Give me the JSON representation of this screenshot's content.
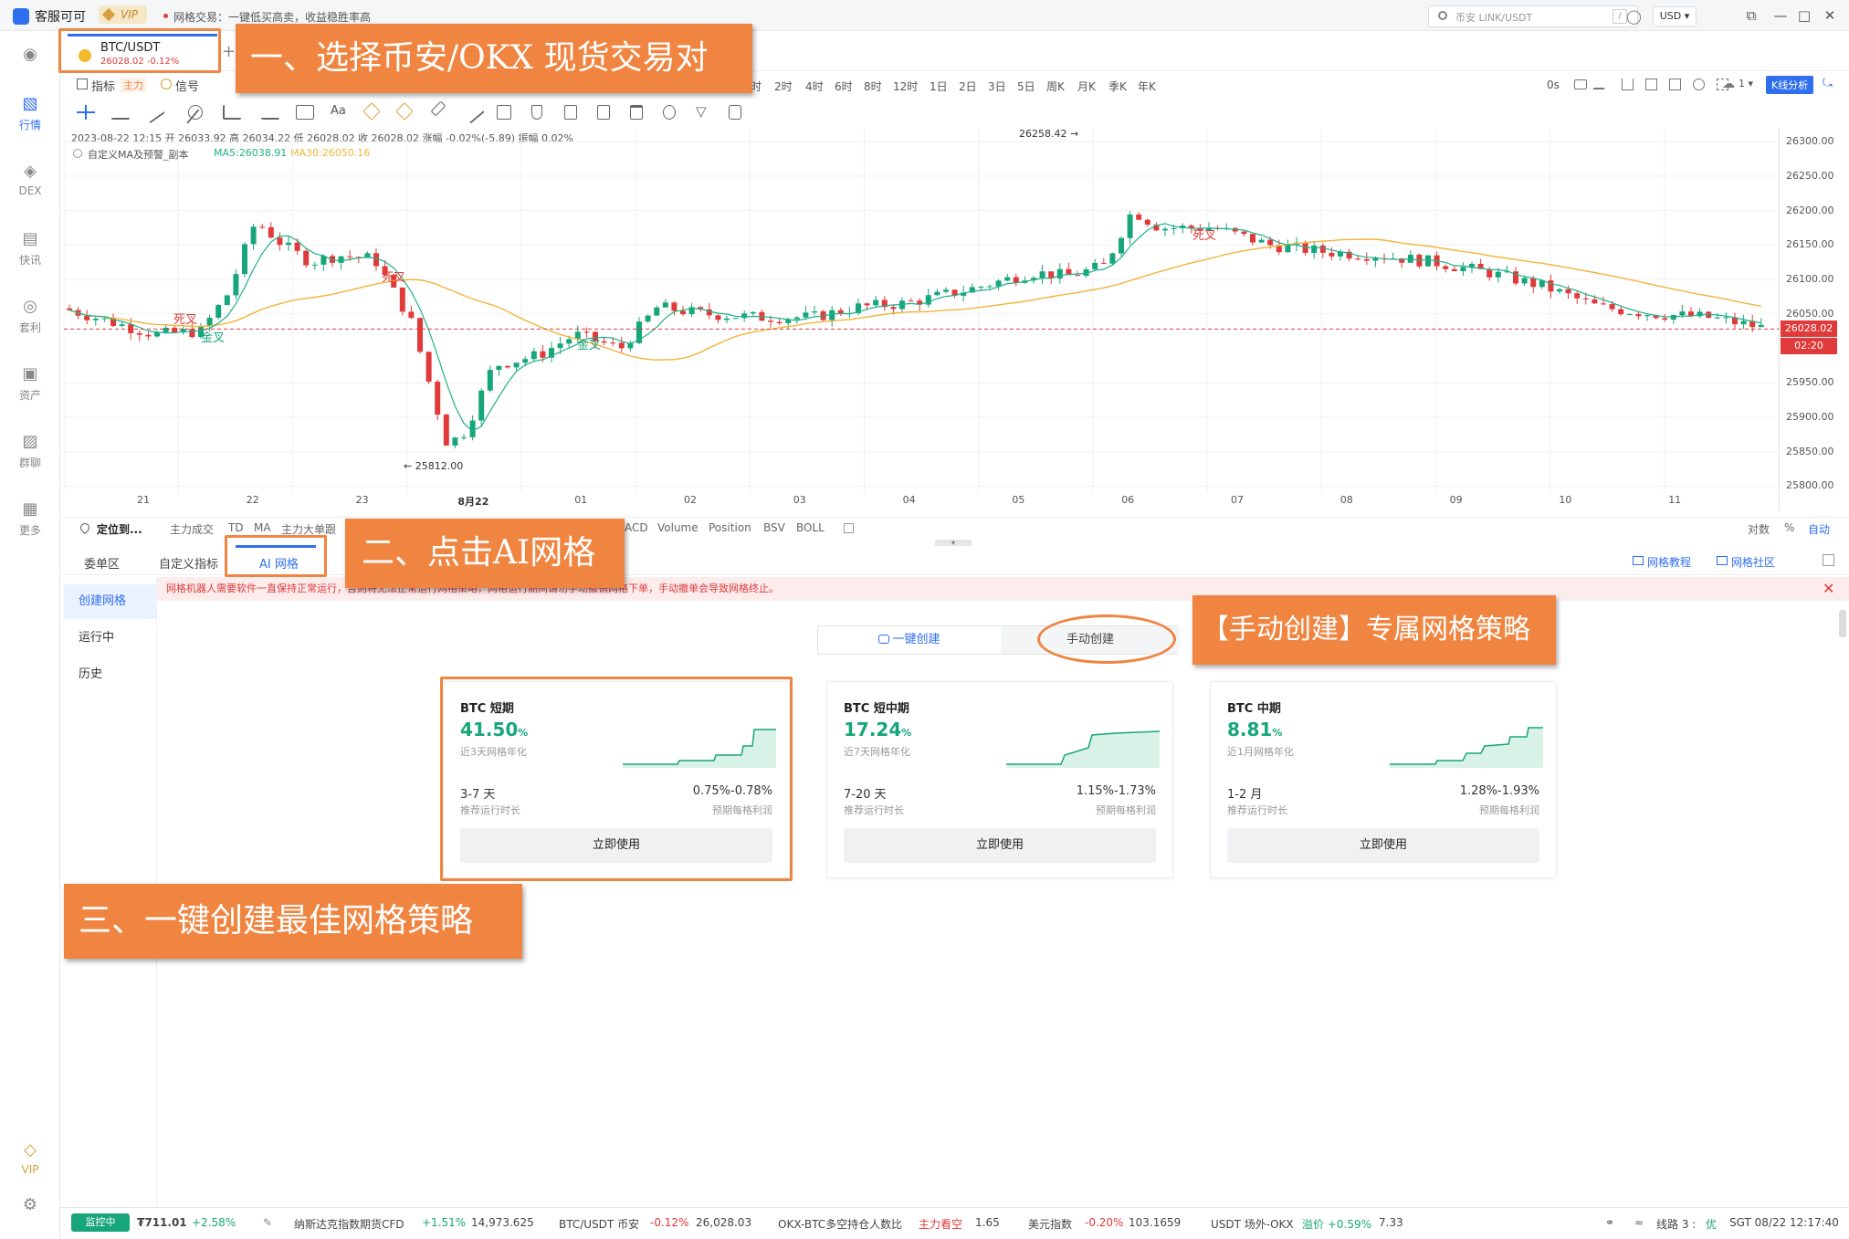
{
  "titlebar": {
    "app_name": "客服可可",
    "vip": "VIP",
    "notice": "网格交易：一键低买高卖，收益稳胜率高",
    "search_placeholder": "币安 LINK/USDT",
    "search_key": "/",
    "currency": "USD ▾"
  },
  "nav": [
    {
      "label": "",
      "icon": "globe-icon"
    },
    {
      "label": "行情",
      "icon": "chart-bars-icon"
    },
    {
      "label": "DEX",
      "icon": "dex-icon"
    },
    {
      "label": "快讯",
      "icon": "news-icon"
    },
    {
      "label": "套利",
      "icon": "arbitrage-icon"
    },
    {
      "label": "资产",
      "icon": "wallet-icon"
    },
    {
      "label": "群聊",
      "icon": "chat-icon"
    },
    {
      "label": "更多",
      "icon": "grid-icon"
    },
    {
      "label": "VIP",
      "icon": "vip-icon"
    },
    {
      "label": "",
      "icon": "settings-icon"
    }
  ],
  "symbol": {
    "pair": "BTC/USDT",
    "price": "26028.02  -0.12%"
  },
  "toolbar": {
    "indicator": "指标",
    "main": "主力",
    "signal": "信号",
    "timeframes": [
      "时",
      "2时",
      "4时",
      "6时",
      "8时",
      "12时",
      "1日",
      "2日",
      "3日",
      "5日",
      "周K",
      "月K",
      "季K",
      "年K"
    ],
    "countdown": "0s",
    "layout_count": "1 ▾",
    "k_analysis": "K线分析",
    "drawing_text": "Aa"
  },
  "chart_info": {
    "line1": "2023-08-22 12:15  开 26033.92  高 26034.22  低 26028.02  收 26028.02  涨幅 -0.02%(-5.89)  振幅 0.02%",
    "line2_name": "自定义MA及预警_副本",
    "ma5": "MA5:26038.91",
    "ma30": "MA30:26050.16"
  },
  "chart_data": {
    "type": "candlestick",
    "y_ticks": [
      "26300.00",
      "26250.00",
      "26200.00",
      "26150.00",
      "26100.00",
      "26050.00",
      "25950.00",
      "25900.00",
      "25850.00",
      "25800.00"
    ],
    "ylim": [
      25790,
      26320
    ],
    "x_ticks": [
      "21",
      "22",
      "23",
      "8月22",
      "01",
      "02",
      "03",
      "04",
      "05",
      "06",
      "07",
      "08",
      "09",
      "10",
      "11"
    ],
    "last_price": "26028.02",
    "last_price_value": 26028.02,
    "countdown_tag": "02:20",
    "high_label": "26258.42",
    "low_label": "25812.00",
    "annotations": [
      {
        "text": "死叉",
        "kind": "dead-cross"
      },
      {
        "text": "金叉",
        "kind": "golden-cross"
      },
      {
        "text": "死叉",
        "kind": "dead-cross"
      },
      {
        "text": "金叉",
        "kind": "golden-cross"
      },
      {
        "text": "死叉",
        "kind": "dead-cross"
      }
    ],
    "colors": {
      "up": "#17a67a",
      "down": "#e03a3a",
      "ma5": "#1fb089",
      "ma30": "#f3b43a"
    }
  },
  "indbar": {
    "locate": "定位到...",
    "items": [
      "主力成交",
      "TD",
      "MA",
      "主力大单跟",
      "ACD",
      "Volume",
      "Position",
      "BSV",
      "BOLL"
    ],
    "right": [
      "对数",
      "%",
      "自动"
    ]
  },
  "panel": {
    "tabs": [
      "委单区",
      "自定义指标",
      "AI 网格"
    ],
    "right_links": [
      "网格教程",
      "网格社区"
    ],
    "subnav": [
      "创建网格",
      "运行中",
      "历史"
    ],
    "warning": "网格机器人需要软件一直保持正常运行，否则将无法正常运行网格策略，网格运行期间请勿手动撤销网格下单，手动撤单会导致网格终止。",
    "seg": [
      "一键创建",
      "手动创建"
    ],
    "cards": [
      {
        "title": "BTC 短期",
        "rate": "41.50",
        "rate_unit": "%",
        "rate_sub": "近3天网格年化",
        "dur": "3-7 天",
        "dur_sub": "推荐运行时长",
        "profit": "0.75%-0.78%",
        "profit_sub": "预期每格利润",
        "button": "立即使用"
      },
      {
        "title": "BTC 短中期",
        "rate": "17.24",
        "rate_unit": "%",
        "rate_sub": "近7天网格年化",
        "dur": "7-20 天",
        "dur_sub": "推荐运行时长",
        "profit": "1.15%-1.73%",
        "profit_sub": "预期每格利润",
        "button": "立即使用"
      },
      {
        "title": "BTC 中期",
        "rate": "8.81",
        "rate_unit": "%",
        "rate_sub": "近1月网格年化",
        "dur": "1-2 月",
        "dur_sub": "推荐运行时长",
        "profit": "1.28%-1.93%",
        "profit_sub": "预期每格利润",
        "button": "立即使用"
      }
    ]
  },
  "annotations": {
    "a1": "一、选择币安/OKX 现货交易对",
    "a2": "二、点击AI网格",
    "a3": "【手动创建】专属网格策略",
    "a4": "三、一键创建最佳网格策略"
  },
  "footer": {
    "monitor": "监控中",
    "balance": "₮711.01",
    "balance_chg": "+2.58%",
    "items": [
      {
        "name": "纳斯达克指数期货CFD",
        "chg": "+1.51%",
        "val": "14,973.625",
        "dir": "up"
      },
      {
        "name": "BTC/USDT 币安",
        "chg": "-0.12%",
        "val": "26,028.03",
        "dir": "dn"
      },
      {
        "name": "OKX-BTC多空持仓人数比",
        "chg": "主力看空",
        "val": "1.65",
        "dir": "dn"
      },
      {
        "name": "美元指数",
        "chg": "-0.20%",
        "val": "103.1659",
        "dir": "dn"
      },
      {
        "name": "USDT 场外-OKX",
        "chg": "溢价 +0.59%",
        "val": "7.33",
        "dir": "up"
      }
    ],
    "line": "线路 3 :",
    "line_status": "优",
    "clock": "SGT  08/22 12:17:40"
  }
}
